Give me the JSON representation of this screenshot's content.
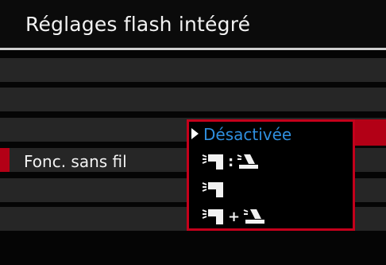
{
  "header": {
    "title": "Réglages flash intégré"
  },
  "menu": {
    "wireless_label": "Fonc. sans fil"
  },
  "dropdown": {
    "selected_label": "Désactivée",
    "options": [
      {
        "label": "Désactivée",
        "selected": true
      },
      {
        "icons": [
          "builtin-flash-icon",
          "colon-separator",
          "external-flash-icon"
        ],
        "separator": ":"
      },
      {
        "icons": [
          "builtin-flash-icon"
        ]
      },
      {
        "icons": [
          "builtin-flash-icon",
          "plus-separator",
          "external-flash-icon"
        ],
        "separator": "+"
      }
    ]
  },
  "colors": {
    "accent_red": "#b30016",
    "selected_text": "#2f8fde",
    "row_bg": "#262626",
    "text": "#f2f2f2"
  }
}
